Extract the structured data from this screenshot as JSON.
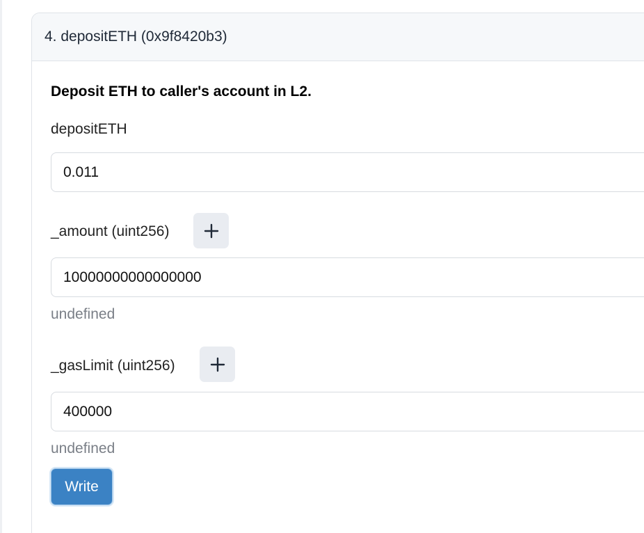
{
  "function": {
    "header": "4. depositETH (0x9f8420b3)",
    "description": "Deposit ETH to caller's account in L2.",
    "payable_label": "depositETH",
    "payable_value": "0.011",
    "params": [
      {
        "label": "_amount (uint256)",
        "value": "10000000000000000",
        "hint": "undefined",
        "add_icon": "plus-icon"
      },
      {
        "label": "_gasLimit (uint256)",
        "value": "400000",
        "hint": "undefined",
        "add_icon": "plus-icon"
      }
    ],
    "submit_label": "Write"
  },
  "colors": {
    "header_bg": "#f6f8fa",
    "button_bg": "#3b82c4",
    "border": "#dfe3e8",
    "hint_text": "#7a7f87"
  }
}
